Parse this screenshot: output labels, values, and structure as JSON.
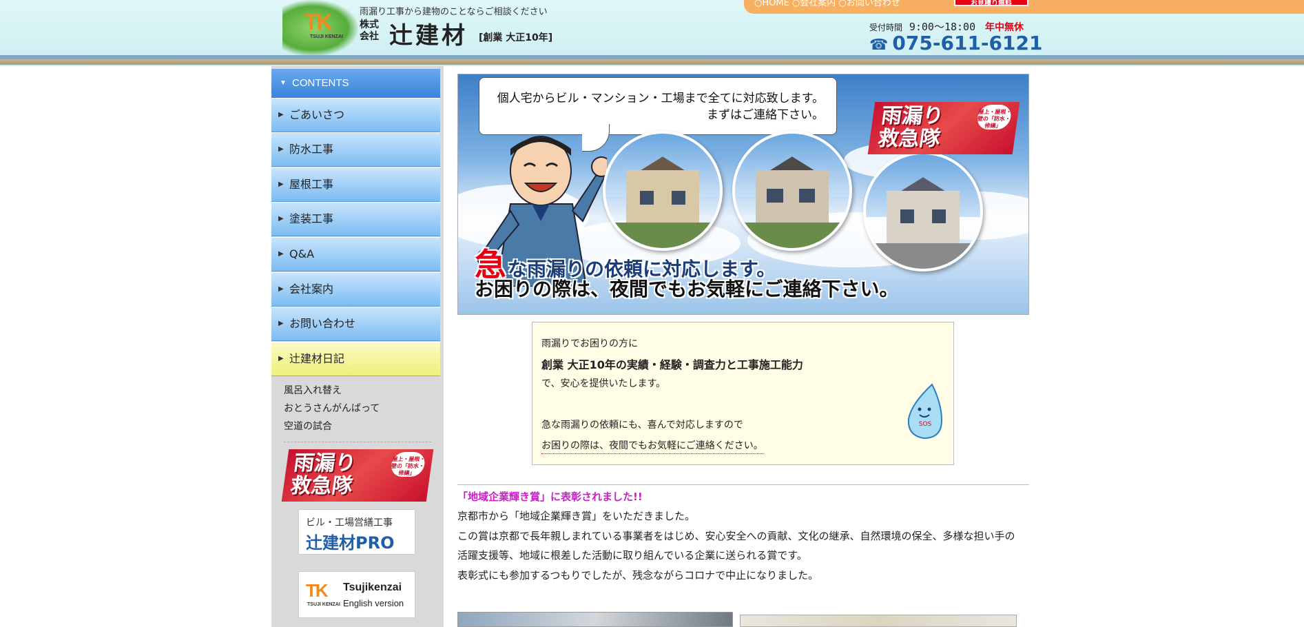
{
  "header": {
    "tagline": "雨漏り工事から建物のことならご相談ください",
    "logo_mark": "TK",
    "logo_sub": "TSUJI KENZAI",
    "company_type": "株式会社",
    "company_name": "辻建材",
    "founded": "[創業 大正10年]",
    "hours_label": "受付時間",
    "hours": "9:00〜18:00",
    "hours_note": "年中無休",
    "phone": "075-611-6121"
  },
  "topnav": {
    "items": "○HOME ○会社案内 ○お問い合わせ",
    "badge": "お見積り無料"
  },
  "sidebar": {
    "contents_label": "CONTENTS",
    "items": [
      {
        "label": "ごあいさつ"
      },
      {
        "label": "防水工事"
      },
      {
        "label": "屋根工事"
      },
      {
        "label": "塗装工事"
      },
      {
        "label": "Q&A"
      },
      {
        "label": "会社案内"
      },
      {
        "label": "お問い合わせ"
      },
      {
        "label": "辻建材日記"
      }
    ],
    "sub_items": [
      {
        "label": "風呂入れ替え"
      },
      {
        "label": "おとうさんがんばって"
      },
      {
        "label": "空道の試合"
      }
    ],
    "banners": {
      "rescue_text1": "雨漏り",
      "rescue_text2": "救急隊",
      "rescue_badge": "屋上・屋根・壁の「防水・修繕」",
      "pro_line1": "ビル・工場営繕工事",
      "pro_line2": "辻建材PRO",
      "en_mark": "TK",
      "en_mark_sub": "TSUJI KENZAI",
      "en_line1": "Tsujikenzai",
      "en_line2": "English version"
    }
  },
  "hero": {
    "bubble_line1": "個人宅からビル・マンション・工場まで全てに対応致します。",
    "bubble_line2": "まずはご連絡下さい。",
    "rescue_text1": "雨漏り",
    "rescue_text2": "救急隊",
    "rescue_badge": "屋上・屋根・壁の「防水・修繕」",
    "line1_big": "急",
    "line1_rest": "な雨漏りの依頼に対応します。",
    "line2": "お困りの際は、夜間でもお気軽にご連絡下さい。"
  },
  "intro": {
    "line1": "雨漏りでお困りの方に",
    "line2": "創業 大正10年の実績・経験・調査力と工事施工能力",
    "line3": "で、安心を提供いたします。",
    "line4": "急な雨漏りの依頼にも、喜んで対応しますので",
    "line5": "お困りの際は、夜間でもお気軽にご連絡ください。",
    "drop_label": "SOS"
  },
  "news": {
    "title": "「地域企業輝き賞」に表彰されました!!",
    "lines": [
      "京都市から「地域企業輝き賞」をいただきました。",
      "この賞は京都で長年親しまれている事業者をはじめ、安心安全への貢献、文化の継承、自然環境の保全、多様な担い手の",
      "活躍支援等、地域に根差した活動に取り組んでいる企業に送られる賞です。",
      "表彰式にも参加するつもりでしたが、残念ながらコロナで中止になりました。"
    ]
  },
  "colors": {
    "accent_blue": "#3a82db",
    "brand_orange": "#f08a1c",
    "alert_red": "#e60012",
    "news_magenta": "#c81fc8",
    "active_yellow": "#f0ef7c"
  }
}
